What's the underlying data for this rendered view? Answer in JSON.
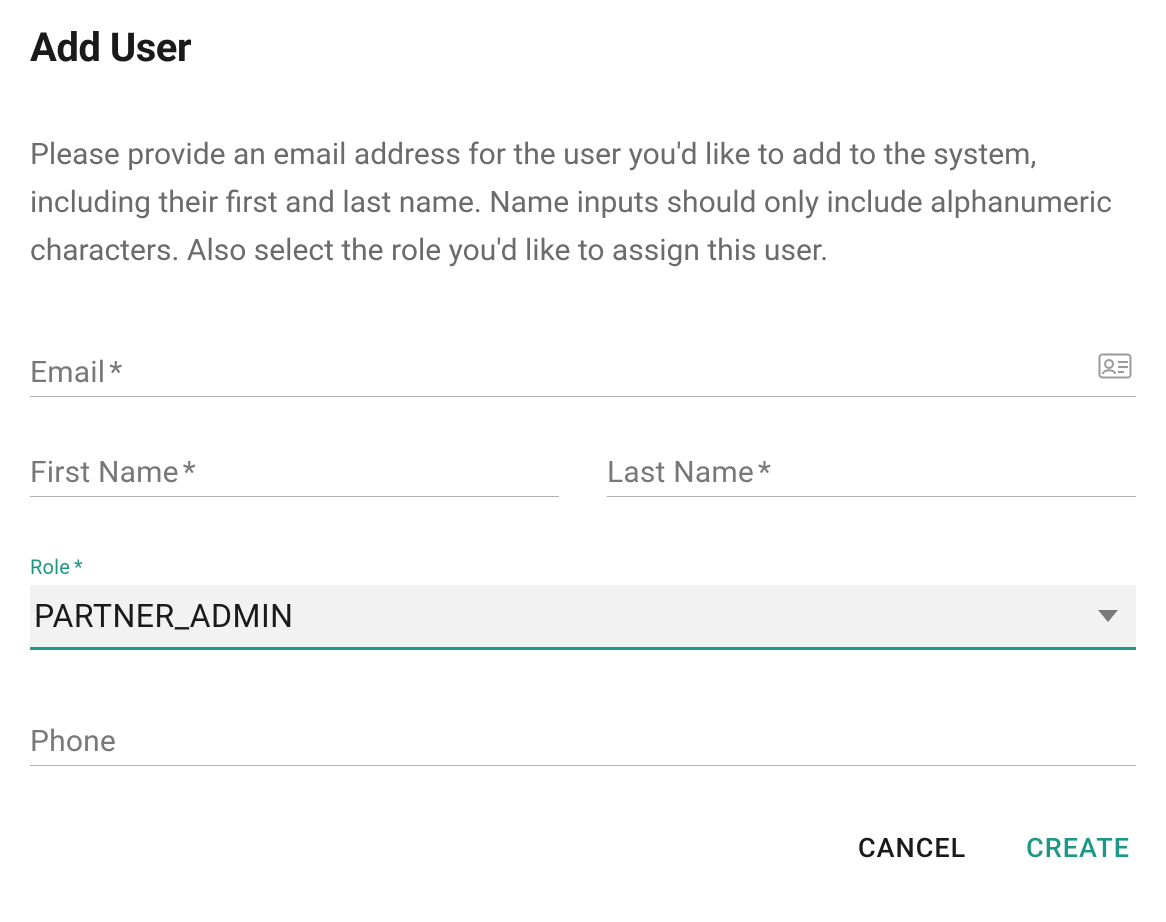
{
  "colors": {
    "accent": "#1d9888"
  },
  "dialog": {
    "title": "Add User",
    "description": "Please provide an email address for the user you'd like to add to the system, including their first and last name. Name inputs should only include alphanumeric characters. Also select the role you'd like to assign this user."
  },
  "fields": {
    "email": {
      "label": "Email",
      "required_mark": "*",
      "value": ""
    },
    "first_name": {
      "label": "First Name",
      "required_mark": "*",
      "value": ""
    },
    "last_name": {
      "label": "Last Name",
      "required_mark": "*",
      "value": ""
    },
    "role": {
      "label": "Role",
      "required_mark": "*",
      "value": "PARTNER_ADMIN"
    },
    "phone": {
      "label": "Phone",
      "value": ""
    }
  },
  "actions": {
    "cancel": "CANCEL",
    "create": "CREATE"
  }
}
